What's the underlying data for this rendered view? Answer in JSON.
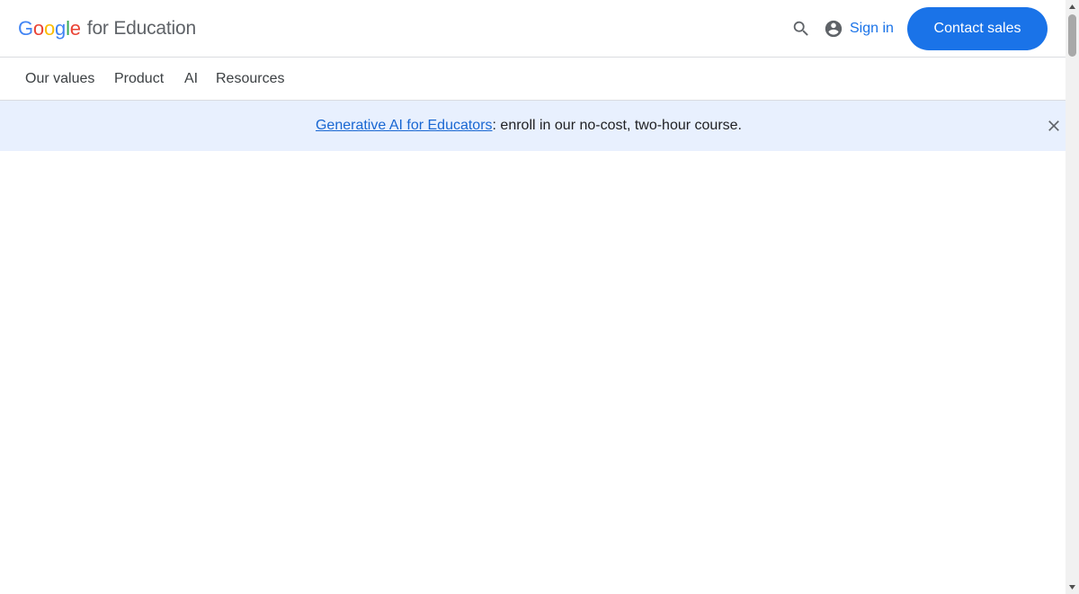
{
  "header": {
    "logo_word_letters": [
      {
        "char": "G",
        "color": "#4285F4"
      },
      {
        "char": "o",
        "color": "#EA4335"
      },
      {
        "char": "o",
        "color": "#FBBC05"
      },
      {
        "char": "g",
        "color": "#4285F4"
      },
      {
        "char": "l",
        "color": "#34A853"
      },
      {
        "char": "e",
        "color": "#EA4335"
      }
    ],
    "logo_suffix": "for Education",
    "search_icon": "search-icon",
    "account_icon": "account-circle-icon",
    "signin_label": "Sign in",
    "contact_label": "Contact sales"
  },
  "nav": {
    "items": [
      {
        "label": "Our values"
      },
      {
        "label": "Product"
      },
      {
        "label": "AI"
      },
      {
        "label": "Resources"
      }
    ]
  },
  "banner": {
    "link_text": "Generative AI for Educators",
    "rest_text": ": enroll in our no-cost, two-hour course.",
    "close_icon": "close-icon"
  },
  "colors": {
    "accent": "#1a73e8",
    "banner_bg": "#e8f0fe",
    "link": "#1967d2",
    "nav_text": "#3c4043",
    "logo_suffix": "#5f6368"
  }
}
